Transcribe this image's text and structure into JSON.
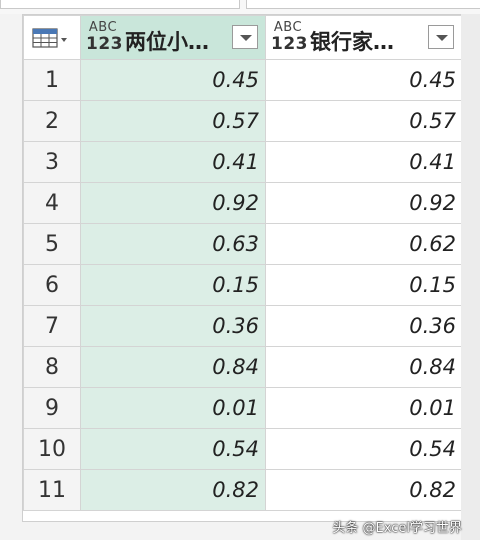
{
  "columns": [
    {
      "type_top": "ABC",
      "type_bottom": "123",
      "name": "两位小…"
    },
    {
      "type_top": "ABC",
      "type_bottom": "123",
      "name": "银行家…"
    }
  ],
  "rows": [
    {
      "n": "1",
      "a": "0.45",
      "b": "0.45"
    },
    {
      "n": "2",
      "a": "0.57",
      "b": "0.57"
    },
    {
      "n": "3",
      "a": "0.41",
      "b": "0.41"
    },
    {
      "n": "4",
      "a": "0.92",
      "b": "0.92"
    },
    {
      "n": "5",
      "a": "0.63",
      "b": "0.62"
    },
    {
      "n": "6",
      "a": "0.15",
      "b": "0.15"
    },
    {
      "n": "7",
      "a": "0.36",
      "b": "0.36"
    },
    {
      "n": "8",
      "a": "0.84",
      "b": "0.84"
    },
    {
      "n": "9",
      "a": "0.01",
      "b": "0.01"
    },
    {
      "n": "10",
      "a": "0.54",
      "b": "0.54"
    },
    {
      "n": "11",
      "a": "0.82",
      "b": "0.82"
    }
  ],
  "watermark": "头条 @Excel学习世界",
  "colors": {
    "selected_column": "#dceee6",
    "selected_header": "#c9e6da"
  }
}
